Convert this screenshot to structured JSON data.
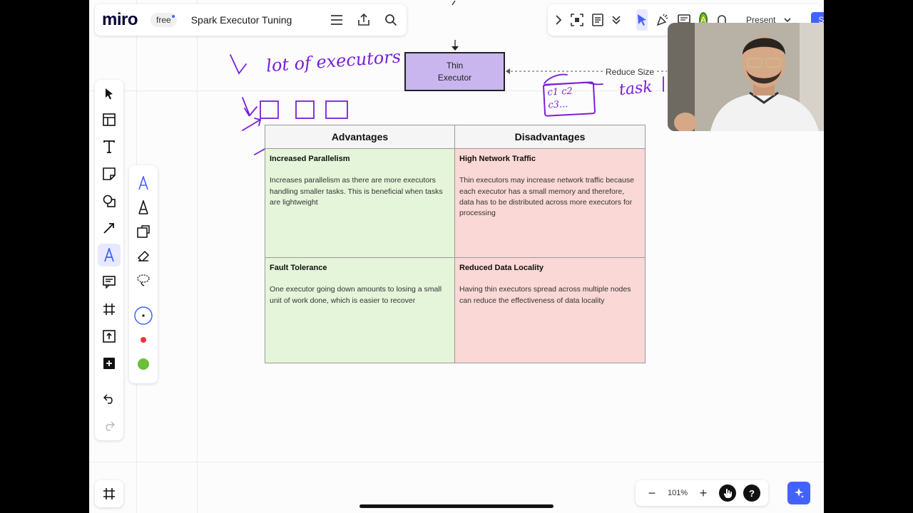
{
  "app": {
    "logo": "miro",
    "plan": "free",
    "board_title": "Spark Executor Tuning"
  },
  "top_right": {
    "avatar_initial": "A",
    "present_label": "Present",
    "share_label": "Share"
  },
  "zoom": {
    "level": "101%"
  },
  "board": {
    "thin_executor": {
      "line1": "Thin",
      "line2": "Executor"
    },
    "reduce_size_label": "Reduce Size",
    "handwriting": {
      "note1": "lot of executors",
      "note2": "task",
      "box_text1": "c1 c2",
      "box_text2": "c3..."
    },
    "matrix": {
      "headers": [
        "Advantages",
        "Disadvantages"
      ],
      "cells": [
        {
          "title": "Increased Parallelism",
          "body": "Increases parallelism as there are more executors handling smaller tasks. This is beneficial when tasks are lightweight"
        },
        {
          "title": "High Network Traffic",
          "body": "Thin executors may increase network traffic because each executor has a small memory and therefore, data has to be distributed across more executors for processing"
        },
        {
          "title": "Fault Tolerance",
          "body": "One executor going down amounts to losing a small unit of work done, which is easier to recover"
        },
        {
          "title": "Reduced Data Locality",
          "body": "Having thin executors spread across multiple nodes can reduce the effectiveness of data locality"
        }
      ]
    }
  },
  "colors": {
    "accent": "#4262ff",
    "pen": "#7a1fd6",
    "advantage_bg": "#e5f5d9",
    "disadvantage_bg": "#fad8d5",
    "thin_executor_bg": "#c9b6ef"
  }
}
